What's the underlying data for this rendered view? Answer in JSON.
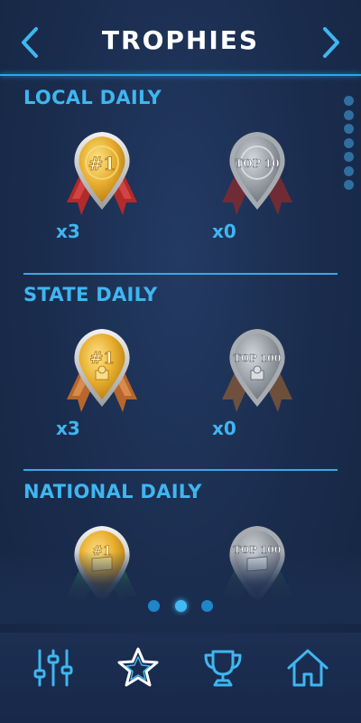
{
  "header": {
    "title": "TROPHIES",
    "prev_icon": "chevron-left-icon",
    "next_icon": "chevron-right-icon"
  },
  "sections": [
    {
      "title": "LOCAL DAILY",
      "trophies": [
        {
          "label": "#1",
          "medal": "gold",
          "ribbon": "red",
          "count": "x3"
        },
        {
          "label": "TOP 10",
          "medal": "silver",
          "ribbon": "red",
          "count": "x0"
        }
      ]
    },
    {
      "title": "STATE DAILY",
      "trophies": [
        {
          "label": "#1",
          "medal": "gold",
          "ribbon": "bronze",
          "count": "x3"
        },
        {
          "label": "TOP 100",
          "medal": "silver",
          "ribbon": "bronze",
          "count": "x0"
        }
      ]
    },
    {
      "title": "NATIONAL DAILY",
      "trophies": [
        {
          "label": "#1",
          "medal": "gold",
          "ribbon": "green"
        },
        {
          "label": "TOP 100",
          "medal": "silver",
          "ribbon": "green"
        }
      ]
    }
  ],
  "pagination": {
    "pages": 3,
    "current": 2
  },
  "bottom_nav": [
    "sliders-icon",
    "star-icon",
    "trophy-icon",
    "home-icon"
  ],
  "colors": {
    "accent": "#3fb6f0",
    "background": "#1b2d4f",
    "gold": "#e3a92a",
    "silver": "#8d949c"
  }
}
